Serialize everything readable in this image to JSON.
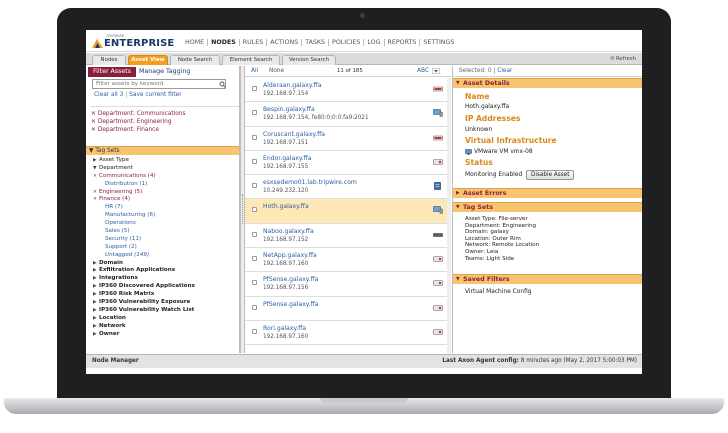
{
  "header": {
    "logo_small": "TRIPWIRE",
    "logo_text": "ENTERPRISE",
    "nav": [
      "HOME",
      "NODES",
      "RULES",
      "ACTIONS",
      "TASKS",
      "POLICIES",
      "LOG",
      "REPORTS",
      "SETTINGS"
    ],
    "active_nav": "NODES"
  },
  "tabs": [
    "Nodes",
    "Asset View",
    "Node Search",
    "Element Search",
    "Version Search"
  ],
  "active_tab": "Asset View",
  "refresh_label": "Refresh",
  "left": {
    "filter_tab": "Filter Assets",
    "manage_tab": "Manage Tagging",
    "search_placeholder": "Filter assets by keyword",
    "clear_all": "Clear all 3",
    "save_filter": "Save current filter",
    "criteria": [
      "Department: Communications",
      "Department: Engineering",
      "Department: Finance"
    ],
    "tag_sets_label": "Tag Sets",
    "tree": [
      {
        "label": "Asset Type",
        "level": 1,
        "marker": "▶",
        "style": ""
      },
      {
        "label": "Department",
        "level": 1,
        "marker": "▼",
        "style": ""
      },
      {
        "label": "Communications (4)",
        "level": 1,
        "marker": "✕",
        "style": "sel"
      },
      {
        "label": "Distribution (1)",
        "level": 2,
        "marker": "",
        "style": "link"
      },
      {
        "label": "Engineering (5)",
        "level": 1,
        "marker": "✕",
        "style": "sel"
      },
      {
        "label": "Finance (4)",
        "level": 1,
        "marker": "✕",
        "style": "sel"
      },
      {
        "label": "HR (7)",
        "level": 2,
        "marker": "",
        "style": "link"
      },
      {
        "label": "Manufacturing (6)",
        "level": 2,
        "marker": "",
        "style": "link"
      },
      {
        "label": "Operations",
        "level": 2,
        "marker": "",
        "style": "link"
      },
      {
        "label": "Sales (5)",
        "level": 2,
        "marker": "",
        "style": "link"
      },
      {
        "label": "Security (11)",
        "level": 2,
        "marker": "",
        "style": "link"
      },
      {
        "label": "Support (2)",
        "level": 2,
        "marker": "",
        "style": "link"
      },
      {
        "label": "Untagged (149)",
        "level": 2,
        "marker": "",
        "style": "ital"
      },
      {
        "label": "Domain",
        "level": 1,
        "marker": "▶",
        "style": "bold"
      },
      {
        "label": "Exfiltration Applications",
        "level": 1,
        "marker": "▶",
        "style": "bold"
      },
      {
        "label": "Integrations",
        "level": 1,
        "marker": "▶",
        "style": "bold"
      },
      {
        "label": "IP360 Discovered Applications",
        "level": 1,
        "marker": "▶",
        "style": "bold"
      },
      {
        "label": "IP360 Risk Matrix",
        "level": 1,
        "marker": "▶",
        "style": "bold"
      },
      {
        "label": "IP360 Vulnerability Exposure",
        "level": 1,
        "marker": "▶",
        "style": "bold"
      },
      {
        "label": "IP360 Vulnerability Watch List",
        "level": 1,
        "marker": "▶",
        "style": "bold"
      },
      {
        "label": "Location",
        "level": 1,
        "marker": "▶",
        "style": "bold"
      },
      {
        "label": "Network",
        "level": 1,
        "marker": "▶",
        "style": "bold"
      },
      {
        "label": "Owner",
        "level": 1,
        "marker": "▶",
        "style": "bold"
      }
    ]
  },
  "middle": {
    "all_label": "All",
    "none_label": "None",
    "count": "11 of 185",
    "sort_label": "ABC",
    "assets": [
      {
        "name": "Alderaan.galaxy.ffa",
        "ip": "192.168.97.154",
        "icon": "red-box-icon",
        "selected": false
      },
      {
        "name": "Bespin.galaxy.ffa",
        "ip": "192.168.97.154, fe80:0:0:0:fa9:2021",
        "icon": "monitor-icon",
        "selected": false
      },
      {
        "name": "Coruscant.galaxy.ffa",
        "ip": "192.168.97.151",
        "icon": "red-box-icon",
        "selected": false
      },
      {
        "name": "Endor.galaxy.ffa",
        "ip": "192.168.97.155",
        "icon": "disk-icon",
        "selected": false
      },
      {
        "name": "esxsedemo01.lab.tripwire.com",
        "ip": "10.249.232.120",
        "icon": "server-icon",
        "selected": false
      },
      {
        "name": "Hoth.galaxy.ffa",
        "ip": "",
        "icon": "monitor-icon",
        "selected": true
      },
      {
        "name": "Naboo.galaxy.ffa",
        "ip": "192.168.97.152",
        "icon": "switch-icon",
        "selected": false
      },
      {
        "name": "NetApp.galaxy.ffa",
        "ip": "192.168.97.160",
        "icon": "disk-icon",
        "selected": false
      },
      {
        "name": "PfSense.galaxy.ffa",
        "ip": "192.168.97.156",
        "icon": "disk-icon",
        "selected": false
      },
      {
        "name": "PfSense.galaxy.ffa",
        "ip": "",
        "icon": "disk-icon",
        "selected": false
      },
      {
        "name": "Rori.galaxy.ffa",
        "ip": "192.168.97.160",
        "icon": "disk-icon",
        "selected": false
      }
    ]
  },
  "right": {
    "selected_label": "Selected: 0",
    "clear_label": "Clear",
    "asset_details": "Asset Details",
    "name_label": "Name",
    "name_value": "Hoth.galaxy.ffa",
    "ip_label": "IP Addresses",
    "ip_value": "Unknown",
    "vi_label": "Virtual Infrastructure",
    "vi_value": "VMware VM vmx-08",
    "status_label": "Status",
    "status_value": "Monitoring Enabled",
    "disable_button": "Disable Asset",
    "asset_errors": "Asset Errors",
    "tag_sets": "Tag Sets",
    "tags": [
      "Asset Type: File-server",
      "Department: Engineering",
      "Domain: galaxy",
      "Location: Outer Rim",
      "Network: Remote Location",
      "Owner: Leia",
      "Teams: Light Side"
    ],
    "saved_filters": "Saved Filters",
    "saved_filter_item": "Virtual Machine Config"
  },
  "status": {
    "left": "Node Manager",
    "right_label": "Last Axon Agent config:",
    "right_value": "8 minutes ago (May 2, 2017 5:00:03 PM)"
  },
  "colors": {
    "accent_orange": "#f2a01c",
    "section_bg": "#f7c46f",
    "maroon": "#8a1f3d",
    "link_blue": "#2c5fa0",
    "selected_row": "#fde9b8"
  }
}
